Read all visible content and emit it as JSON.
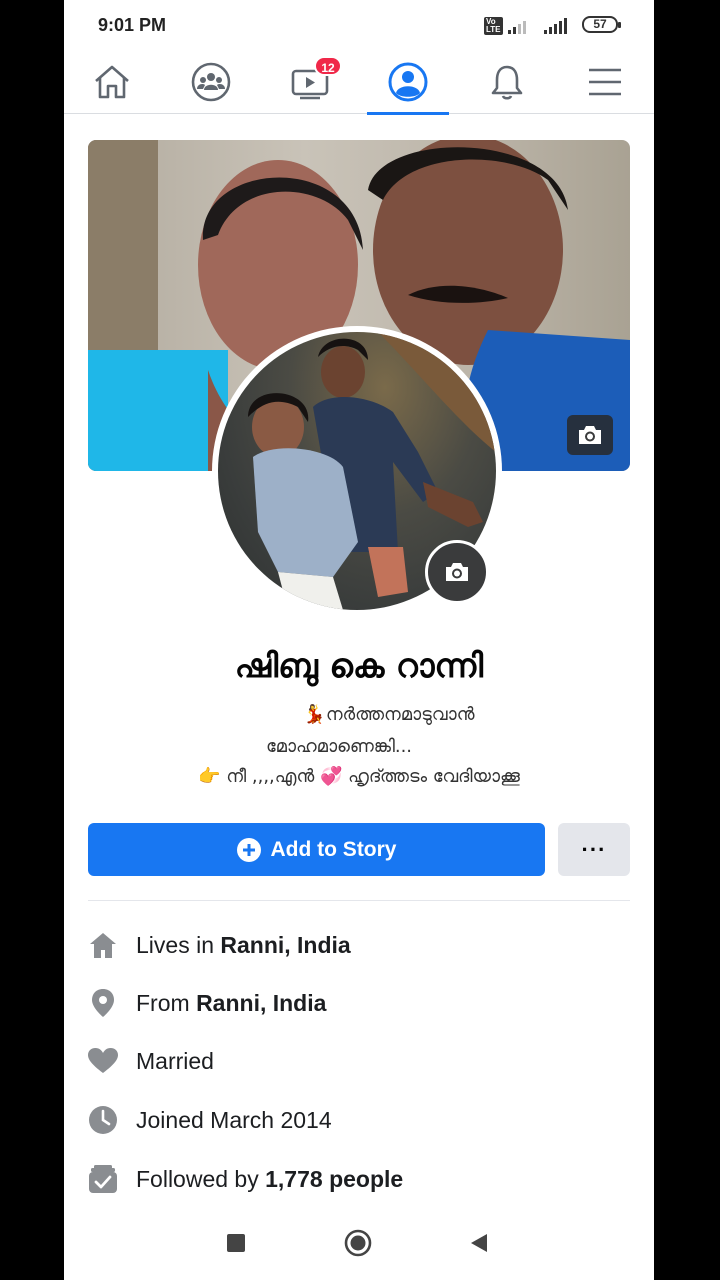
{
  "status": {
    "time": "9:01 PM",
    "volte": "Vo LTE",
    "battery": "57"
  },
  "nav": {
    "items": [
      {
        "icon": "home-icon"
      },
      {
        "icon": "groups-icon"
      },
      {
        "icon": "watch-icon",
        "badge": "12"
      },
      {
        "icon": "profile-icon",
        "active": true
      },
      {
        "icon": "bell-icon"
      },
      {
        "icon": "menu-icon"
      }
    ]
  },
  "profile": {
    "name": "ഷിബു കെ റാന്നി",
    "bio_line1": "💃നർത്തനമാടുവാൻ",
    "bio_line2": "മോഹമാണെങ്കി...",
    "bio_line3": "👉 നീ ,,,,എൻ 💞 ഹൃദ്ത്തടം വേദിയാക്കൂ"
  },
  "actions": {
    "add_story": "Add to Story",
    "more": "···"
  },
  "intro": {
    "lives_prefix": "Lives in ",
    "lives_value": "Ranni, India",
    "from_prefix": "From ",
    "from_value": "Ranni, India",
    "relationship": "Married",
    "joined": "Joined March 2014",
    "followed_prefix": "Followed by ",
    "followed_value": "1,778 people"
  },
  "colors": {
    "accent": "#1877f2",
    "badge": "#f02849"
  }
}
